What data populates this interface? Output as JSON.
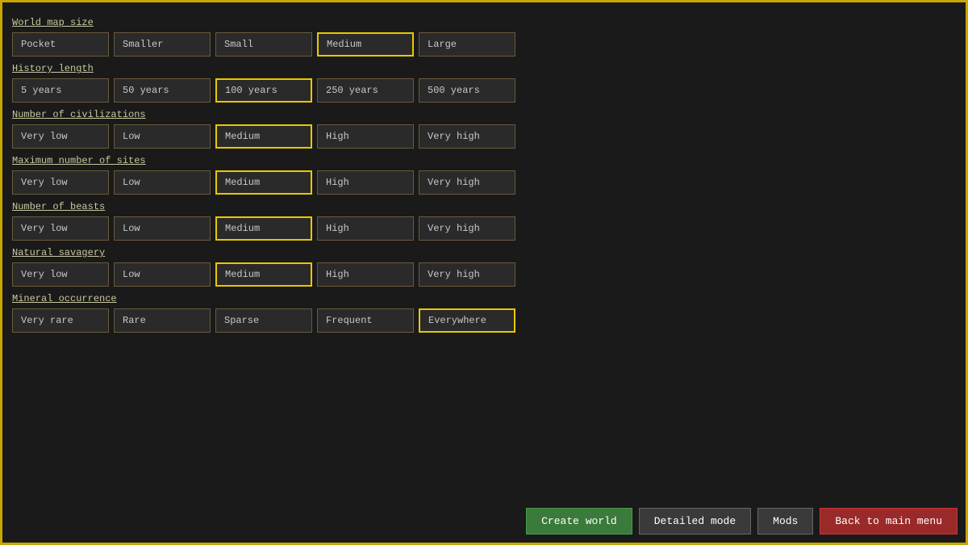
{
  "sections": [
    {
      "id": "world-map-size",
      "label": "World map size",
      "options": [
        "Pocket",
        "Smaller",
        "Small",
        "Medium",
        "Large"
      ],
      "selected": "Medium"
    },
    {
      "id": "history-length",
      "label": "History length",
      "options": [
        "5 years",
        "50 years",
        "100 years",
        "250 years",
        "500 years"
      ],
      "selected": "100 years"
    },
    {
      "id": "num-civilizations",
      "label": "Number of civilizations",
      "options": [
        "Very low",
        "Low",
        "Medium",
        "High",
        "Very high"
      ],
      "selected": "Medium"
    },
    {
      "id": "max-sites",
      "label": "Maximum number of sites",
      "options": [
        "Very low",
        "Low",
        "Medium",
        "High",
        "Very high"
      ],
      "selected": "Medium"
    },
    {
      "id": "num-beasts",
      "label": "Number of beasts",
      "options": [
        "Very low",
        "Low",
        "Medium",
        "High",
        "Very high"
      ],
      "selected": "Medium"
    },
    {
      "id": "natural-savagery",
      "label": "Natural savagery",
      "options": [
        "Very low",
        "Low",
        "Medium",
        "High",
        "Very high"
      ],
      "selected": "Medium"
    },
    {
      "id": "mineral-occurrence",
      "label": "Mineral occurrence",
      "options": [
        "Very rare",
        "Rare",
        "Sparse",
        "Frequent",
        "Everywhere"
      ],
      "selected": "Everywhere"
    }
  ],
  "buttons": {
    "create_world": "Create world",
    "detailed_mode": "Detailed mode",
    "mods": "Mods",
    "back": "Back to main menu"
  }
}
